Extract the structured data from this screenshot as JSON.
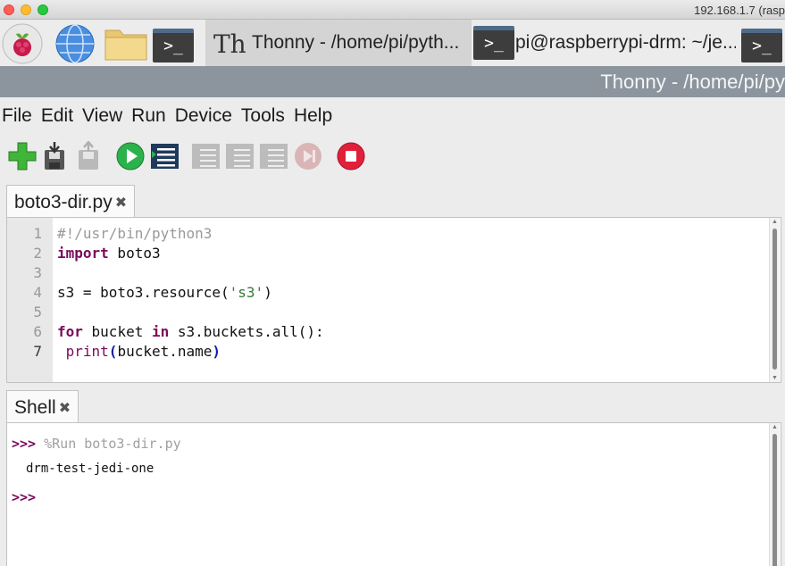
{
  "window": {
    "title": "192.168.1.7 (rasp"
  },
  "taskbar": {
    "thonny_label": "Thonny  -  /home/pi/pyth...",
    "terminal_label": "pi@raspberrypi-drm: ~/je..."
  },
  "app": {
    "header_title": "Thonny  -  /home/pi/py"
  },
  "menu": [
    "File",
    "Edit",
    "View",
    "Run",
    "Device",
    "Tools",
    "Help"
  ],
  "editor": {
    "tab_label": "boto3-dir.py",
    "lines": [
      {
        "n": "1",
        "text": "#!/usr/bin/python3"
      },
      {
        "n": "2",
        "kw": "import",
        "rest": " boto3"
      },
      {
        "n": "3"
      },
      {
        "n": "4",
        "a": "s3 = boto3.resource(",
        "str": "'s3'",
        "b": ")"
      },
      {
        "n": "5"
      },
      {
        "n": "6",
        "kw": "for",
        "mid": " bucket ",
        "kw2": "in",
        "rest": " s3.buckets.all():"
      },
      {
        "n": "7",
        "a": " print",
        "p1": "(",
        "mid": "bucket.name",
        "p2": ")"
      }
    ]
  },
  "shell": {
    "tab_label": "Shell",
    "prompt": ">>>",
    "command": " %Run boto3-dir.py",
    "output": "drm-test-jedi-one"
  },
  "colors": {
    "header": "#8c959d",
    "keyword": "#7a0a5b",
    "string": "#2e7d32",
    "stop": "#e0203a",
    "run": "#2bb24c"
  }
}
